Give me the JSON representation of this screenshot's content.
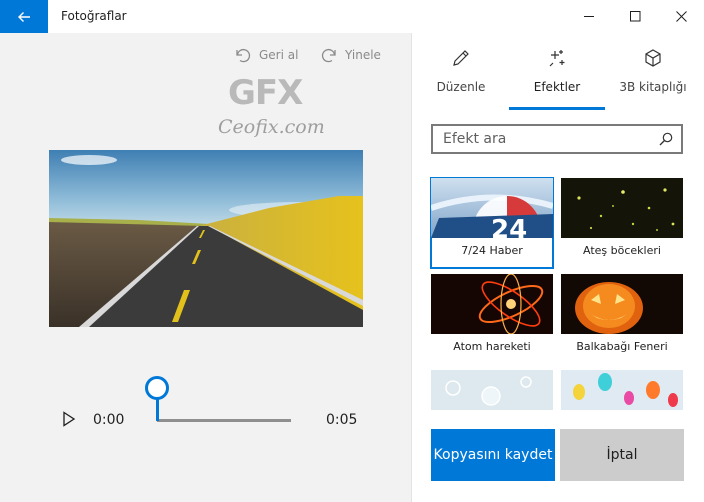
{
  "window": {
    "title": "Fotoğraflar"
  },
  "toolbar": {
    "undo_label": "Geri al",
    "redo_label": "Yinele"
  },
  "watermark": {
    "logo_text": "GFX",
    "site_text": "Ceofix.com"
  },
  "player": {
    "time_start": "0:00",
    "time_end": "0:05",
    "progress": 0.0
  },
  "tabs": [
    {
      "label": "Düzenle",
      "icon": "pencil-icon",
      "active": false
    },
    {
      "label": "Efektler",
      "icon": "sparkle-icon",
      "active": true
    },
    {
      "label": "3B kitaplığı",
      "icon": "cube-icon",
      "active": false
    }
  ],
  "search": {
    "placeholder": "Efekt ara"
  },
  "effects": [
    {
      "label": "7/24 Haber",
      "selected": true
    },
    {
      "label": "Ateş böcekleri",
      "selected": false
    },
    {
      "label": "Atom hareketi",
      "selected": false
    },
    {
      "label": "Balkabağı Feneri",
      "selected": false
    },
    {
      "label": "",
      "selected": false
    },
    {
      "label": "",
      "selected": false
    }
  ],
  "buttons": {
    "save_label": "Kopyasını kaydet",
    "cancel_label": "İptal"
  },
  "colors": {
    "accent": "#0078d7"
  }
}
